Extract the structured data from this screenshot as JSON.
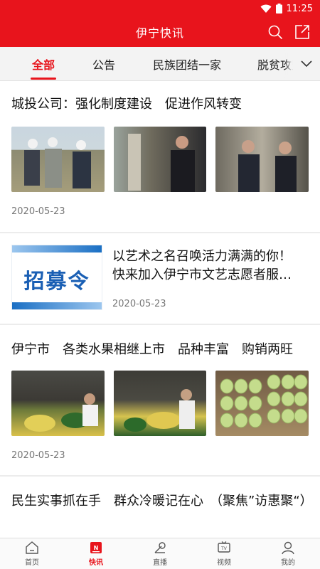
{
  "status_bar": {
    "time": "11:25"
  },
  "header": {
    "title": "伊宁快讯",
    "search_icon": "search-icon",
    "share_icon": "share-icon"
  },
  "tabs": [
    {
      "label": "全部",
      "active": true
    },
    {
      "label": "公告",
      "active": false
    },
    {
      "label": "民族团结一家",
      "active": false
    },
    {
      "label": "脱贫攻坚",
      "active": false
    }
  ],
  "articles": [
    {
      "title": "城投公司：强化制度建设　促进作风转变",
      "date": "2020-05-23"
    },
    {
      "title_line1": "以艺术之名召唤活力满满的你！",
      "title_line2": "快来加入伊宁市文艺志愿者服…",
      "thumb_text": "招募令",
      "date": "2020-05-23"
    },
    {
      "title": "伊宁市　各类水果相继上市　品种丰富　购销两旺",
      "date": "2020-05-23"
    },
    {
      "title": "民生实事抓在手　群众冷暖记在心　（聚焦”访惠聚“）"
    }
  ],
  "bottom_nav": [
    {
      "label": "首页",
      "icon": "home-icon",
      "active": false
    },
    {
      "label": "快讯",
      "icon": "news-icon",
      "active": true
    },
    {
      "label": "直播",
      "icon": "live-icon",
      "active": false
    },
    {
      "label": "视频",
      "icon": "tv-icon",
      "active": false
    },
    {
      "label": "我的",
      "icon": "profile-icon",
      "active": false
    }
  ],
  "colors": {
    "brand_red": "#e8141c",
    "recruit_blue": "#1a5fb4"
  }
}
